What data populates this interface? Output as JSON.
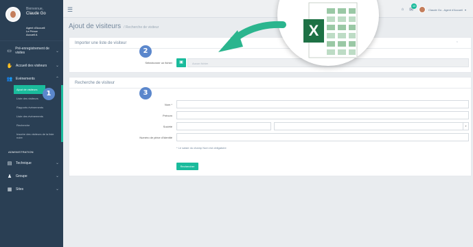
{
  "sidebar": {
    "welcome": "Bienvenue,",
    "user_name": "Claude Go",
    "role_lines": [
      "Agent d'Accueil",
      "Le Prince",
      "Accueil A"
    ],
    "items": [
      {
        "label": "Pré-enregistrement de visites",
        "icon": "monitor-icon"
      },
      {
        "label": "Accueil des visiteurs",
        "icon": "handshake-icon"
      },
      {
        "label": "Evènements",
        "icon": "users-icon"
      }
    ],
    "sub_items": [
      {
        "label": "Ajout de visiteurs",
        "active": true
      },
      {
        "label": "Liste des visiteurs"
      },
      {
        "label": "Rapports évènements"
      },
      {
        "label": "Liste des évènements"
      },
      {
        "label": "Recherche"
      },
      {
        "label": "Inscrire des visiteurs de la liste noire"
      }
    ],
    "admin_title": "ADMINISTRATION",
    "admin_items": [
      {
        "label": "Technique",
        "icon": "server-icon"
      },
      {
        "label": "Groupe",
        "icon": "group-icon"
      },
      {
        "label": "Sites",
        "icon": "building-icon"
      }
    ]
  },
  "topbar": {
    "badge": "10",
    "user": "Claude Go - Agent d'Accueil"
  },
  "page": {
    "title": "Ajout de visiteurs",
    "breadcrumb": "/ Recherche de visiteur"
  },
  "import_panel": {
    "title": "Importer une liste de visiteur",
    "file_label": "Sélectionner un fichier",
    "file_placeholder": "Aucun fichier"
  },
  "search_panel": {
    "title": "Recherche de visiteur",
    "fields": {
      "nom": "Nom *",
      "prenom": "Prénom",
      "societe": "Société",
      "piece": "Numéro de pièce d'Identité"
    },
    "hint": "* Le saisie du champ Nom est obligatoire",
    "submit": "Rechercher"
  },
  "steps": [
    "1",
    "2",
    "3"
  ],
  "excel": {
    "letter": "X"
  },
  "colors": {
    "accent": "#1abb9c",
    "sidebar": "#2a3f54",
    "step": "#5b87cc",
    "excel": "#1e7145",
    "arrow": "#2bb58e"
  }
}
